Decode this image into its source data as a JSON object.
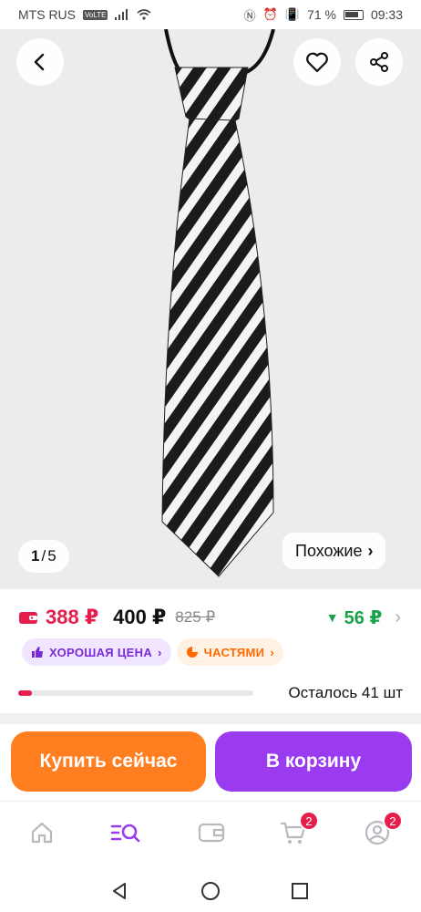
{
  "status_bar": {
    "carrier": "MTS RUS",
    "network_badge": "VoLTE",
    "battery_percent": "71 %",
    "time": "09:33"
  },
  "gallery": {
    "current_page": "1",
    "page_separator": "/",
    "total_pages": "5",
    "similar_label": "Похожие",
    "similar_chevron": "›"
  },
  "price": {
    "wallet_price": "388 ₽",
    "main_price": "400 ₽",
    "old_price": "825 ₽",
    "discount_arrow": "▼",
    "discount_amount": "56 ₽",
    "discount_chevron": "›"
  },
  "badges": {
    "good_price_label": "ХОРОШАЯ ЦЕНА",
    "good_price_chevron": "›",
    "installments_label": "ЧАСТЯМИ",
    "installments_chevron": "›"
  },
  "stock": {
    "remaining_label": "Осталось 41 шт",
    "remaining_fraction": 0.06
  },
  "actions": {
    "buy_now_label": "Купить сейчас",
    "add_to_cart_label": "В корзину"
  },
  "bottom_nav": {
    "cart_badge": "2",
    "profile_badge": "2"
  },
  "colors": {
    "accent_purple": "#9a3bf0",
    "accent_orange": "#ff7e20",
    "price_red": "#e61e4d",
    "discount_green": "#1aa24a"
  },
  "icons": [
    "back-arrow-icon",
    "heart-icon",
    "share-icon",
    "wallet-icon",
    "thumbs-up-icon",
    "pie-icon",
    "home-icon",
    "catalog-search-icon",
    "wallet-nav-icon",
    "cart-icon",
    "profile-icon",
    "triangle-back-icon",
    "circle-home-icon",
    "square-recents-icon"
  ]
}
